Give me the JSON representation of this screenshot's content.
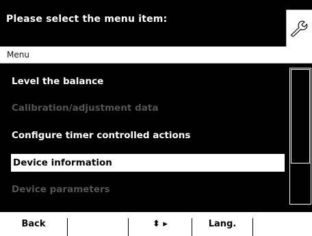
{
  "header": {
    "title": "Please select the menu item:",
    "settings_icon": "wrench-icon"
  },
  "section": {
    "label": "Menu"
  },
  "menu": {
    "items": [
      {
        "label": "Level the balance",
        "state": "enabled"
      },
      {
        "label": "Calibration/adjustment data",
        "state": "disabled"
      },
      {
        "label": "Configure timer controlled actions",
        "state": "enabled"
      },
      {
        "label": "Device information",
        "state": "selected"
      },
      {
        "label": "Device parameters",
        "state": "disabled"
      }
    ]
  },
  "softkeys": {
    "back": "Back",
    "key2": "",
    "navigate": "⬍ ▸",
    "lang": "Lang.",
    "key5": ""
  },
  "colors": {
    "background": "#000000",
    "text": "#ffffff",
    "disabled_text": "#555555",
    "selected_bg": "#ffffff"
  }
}
